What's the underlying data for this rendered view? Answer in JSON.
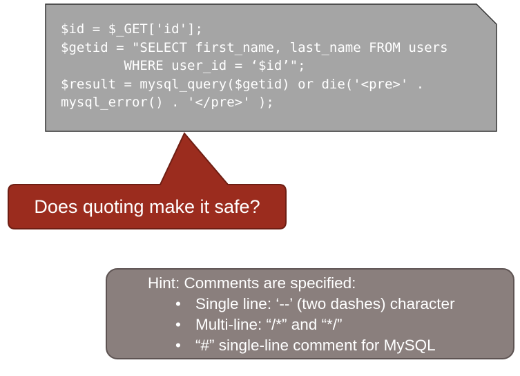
{
  "code_box": {
    "lines": [
      "$id = $_GET['id'];",
      "$getid = \"SELECT first_name, last_name FROM users",
      "        WHERE user_id = ‘$id’\";",
      "$result = mysql_query($getid) or die('<pre>' .",
      "mysql_error() . '</pre>' );"
    ]
  },
  "callout": {
    "text": "Does quoting make it safe?"
  },
  "hint_box": {
    "title": "Hint: Comments are specified:",
    "bullet_glyph": "•",
    "items": [
      "Single line: ‘--’ (two dashes) character",
      "Multi-line: “/*” and “*/”",
      "“#” single-line comment for MySQL"
    ]
  },
  "colors": {
    "code_box_fill": "#a5a5a5",
    "callout_fill": "#9b2c1e",
    "callout_border": "#6e1e13",
    "hint_box_fill": "#8a7f7d",
    "hint_box_border": "#5d5352"
  }
}
